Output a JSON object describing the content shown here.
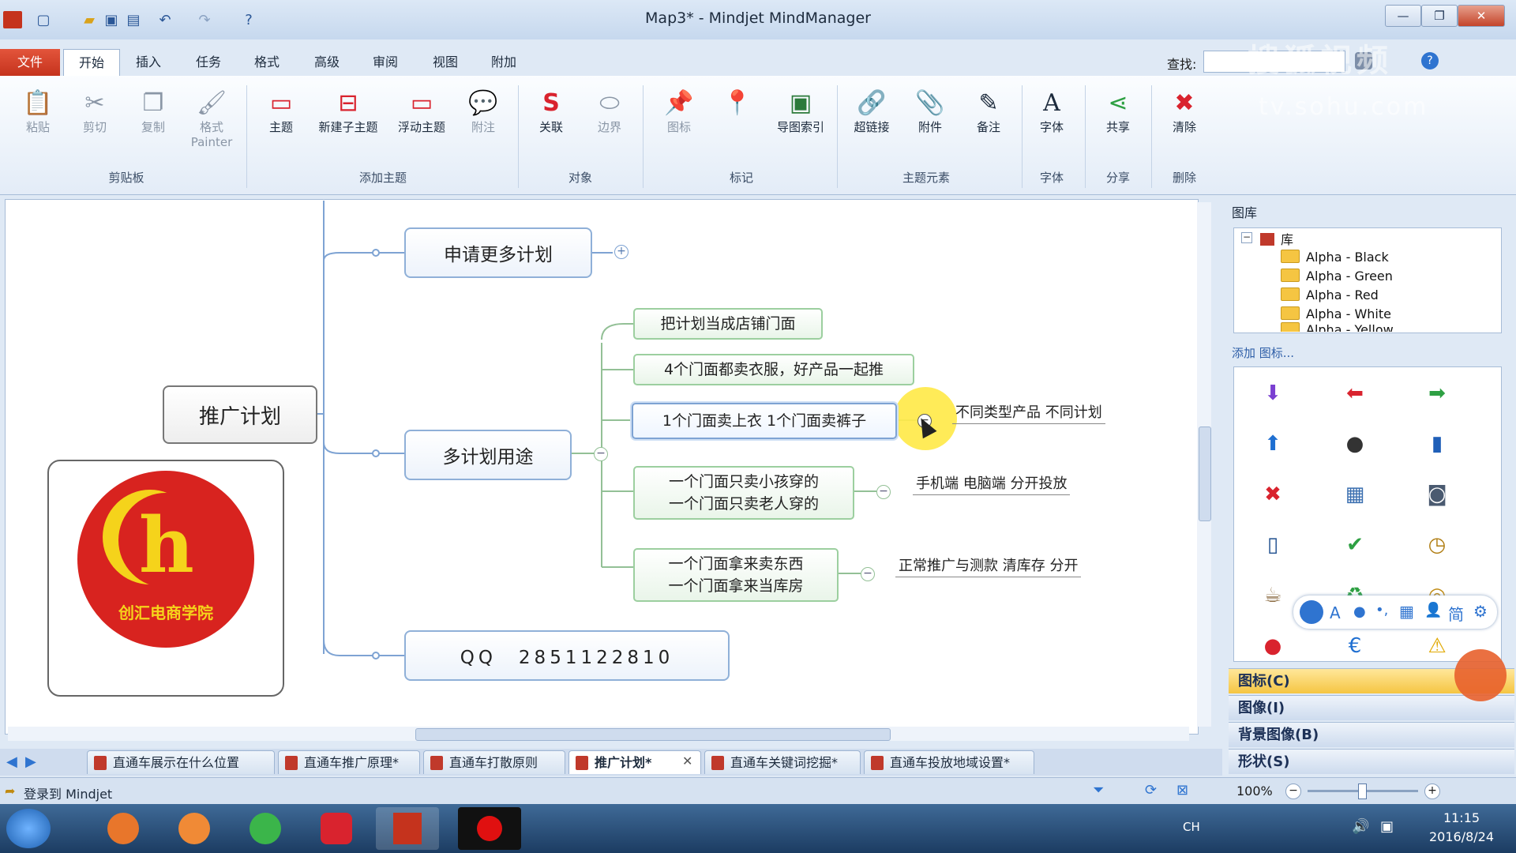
{
  "window": {
    "title": "Map3* - Mindjet MindManager"
  },
  "menu": {
    "tabs": [
      "文件",
      "开始",
      "插入",
      "任务",
      "格式",
      "高级",
      "审阅",
      "视图",
      "附加"
    ]
  },
  "search": {
    "label": "查找:",
    "value": ""
  },
  "ribbon": {
    "buttons": [
      {
        "label": "粘贴",
        "icon": "paste-icon",
        "glyph": "📋"
      },
      {
        "label": "剪切",
        "icon": "scissors-icon",
        "glyph": "✂"
      },
      {
        "label": "复制",
        "icon": "copy-icon",
        "glyph": "❐"
      },
      {
        "label": "格式\nPainter",
        "icon": "format-painter-icon",
        "glyph": "🖌"
      },
      {
        "label": "主题",
        "icon": "topic-icon",
        "glyph": "▭"
      },
      {
        "label": "新建子主题",
        "icon": "subtopic-icon",
        "glyph": "⊟"
      },
      {
        "label": "浮动主题",
        "icon": "floating-topic-icon",
        "glyph": "▭"
      },
      {
        "label": "附注",
        "icon": "callout-icon",
        "glyph": "💬"
      },
      {
        "label": "关联",
        "icon": "relationship-icon",
        "glyph": "S"
      },
      {
        "label": "边界",
        "icon": "boundary-icon",
        "glyph": "⬭"
      },
      {
        "label": "图标",
        "icon": "icon-marker-icon",
        "glyph": "📌"
      },
      {
        "label": "",
        "icon": "pin-icon",
        "glyph": "📍"
      },
      {
        "label": "导图索引",
        "icon": "map-index-icon",
        "glyph": "▣"
      },
      {
        "label": "超链接",
        "icon": "hyperlink-icon",
        "glyph": "🔗"
      },
      {
        "label": "附件",
        "icon": "attachment-icon",
        "glyph": "📎"
      },
      {
        "label": "备注",
        "icon": "notes-icon",
        "glyph": "✎"
      },
      {
        "label": "字体",
        "icon": "font-icon",
        "glyph": "A"
      },
      {
        "label": "共享",
        "icon": "share-icon",
        "glyph": "⋖"
      },
      {
        "label": "清除",
        "icon": "delete-icon",
        "glyph": "✖"
      }
    ],
    "groups": [
      "剪贴板",
      "添加主题",
      "对象",
      "标记",
      "主题元素",
      "字体",
      "分享",
      "删除"
    ]
  },
  "map": {
    "central": "推广计划",
    "main_topics": [
      "申请更多计划",
      "多计划用途",
      "QQ　2851122810"
    ],
    "subtopics": [
      "把计划当成店铺门面",
      "4个门面都卖衣服，好产品一起推",
      "1个门面卖上衣 1个门面卖裤子",
      "一个门面只卖小孩穿的\n一个门面只卖老人穿的",
      "一个门面拿来卖东西\n一个门面拿来当库房"
    ],
    "notes": [
      "不同类型产品 不同计划",
      "手机端 电脑端 分开投放",
      "正常推广与测款 清库存 分开"
    ],
    "logo_text": "创汇电商学院",
    "logo_letter": "h"
  },
  "library": {
    "title": "图库",
    "root": "库",
    "items": [
      "Alpha - Black",
      "Alpha - Green",
      "Alpha - Red",
      "Alpha - White",
      "Alpha - Yellow"
    ],
    "add_icon_link": "添加 图标...",
    "sections": [
      "图标(C)",
      "图像(I)",
      "背景图像(B)",
      "形状(S)"
    ]
  },
  "palette_icons": [
    {
      "name": "arrow-down-purple-icon",
      "glyph": "⬇",
      "color": "#7a3fd1"
    },
    {
      "name": "arrow-left-red-icon",
      "glyph": "⬅",
      "color": "#d9232e"
    },
    {
      "name": "arrow-right-green-icon",
      "glyph": "➡",
      "color": "#2ea043"
    },
    {
      "name": "arrow-up-blue-icon",
      "glyph": "⬆",
      "color": "#1f6fd1"
    },
    {
      "name": "bomb-icon",
      "glyph": "●",
      "color": "#333333"
    },
    {
      "name": "book-icon",
      "glyph": "▮",
      "color": "#1f5fb8"
    },
    {
      "name": "cross-red-icon",
      "glyph": "✖",
      "color": "#d9232e"
    },
    {
      "name": "calendar-icon",
      "glyph": "▦",
      "color": "#3b6fb0"
    },
    {
      "name": "camera-icon",
      "glyph": "◙",
      "color": "#4a5a70"
    },
    {
      "name": "phone-icon",
      "glyph": "▯",
      "color": "#1f4f8f"
    },
    {
      "name": "checkmark-green-icon",
      "glyph": "✔",
      "color": "#2ea043"
    },
    {
      "name": "clock-icon",
      "glyph": "◷",
      "color": "#b07d12"
    },
    {
      "name": "coffee-icon",
      "glyph": "☕",
      "color": "#8a6a40"
    },
    {
      "name": "recycle-icon",
      "glyph": "♻",
      "color": "#2ea043"
    },
    {
      "name": "target-icon",
      "glyph": "◎",
      "color": "#c08a10"
    },
    {
      "name": "pin-red-icon",
      "glyph": "●",
      "color": "#d9232e"
    },
    {
      "name": "euro-icon",
      "glyph": "€",
      "color": "#1f6fd1"
    },
    {
      "name": "warning-icon",
      "glyph": "⚠",
      "color": "#e0a800"
    }
  ],
  "ime_bar": [
    "A",
    "●",
    "•,",
    "▦",
    "👤",
    "简",
    "⚙"
  ],
  "doc_tabs": [
    "直通车展示在什么位置",
    "直通车推广原理*",
    "直通车打散原则",
    "推广计划*",
    "直通车关键词挖掘*",
    "直通车投放地域设置*"
  ],
  "status": {
    "login": "登录到 Mindjet",
    "zoom": "100%"
  },
  "taskbar": {
    "lang": "CH",
    "time": "11:15",
    "date": "2016/8/24"
  },
  "watermark": {
    "line1": "搜狐视频",
    "line2": "tv.sohu.com"
  },
  "colors": {
    "accent": "#c5331d",
    "topic_border": "#8fb0d8",
    "subtopic_border": "#9ccf9f",
    "highlight": "#ffe94a"
  }
}
